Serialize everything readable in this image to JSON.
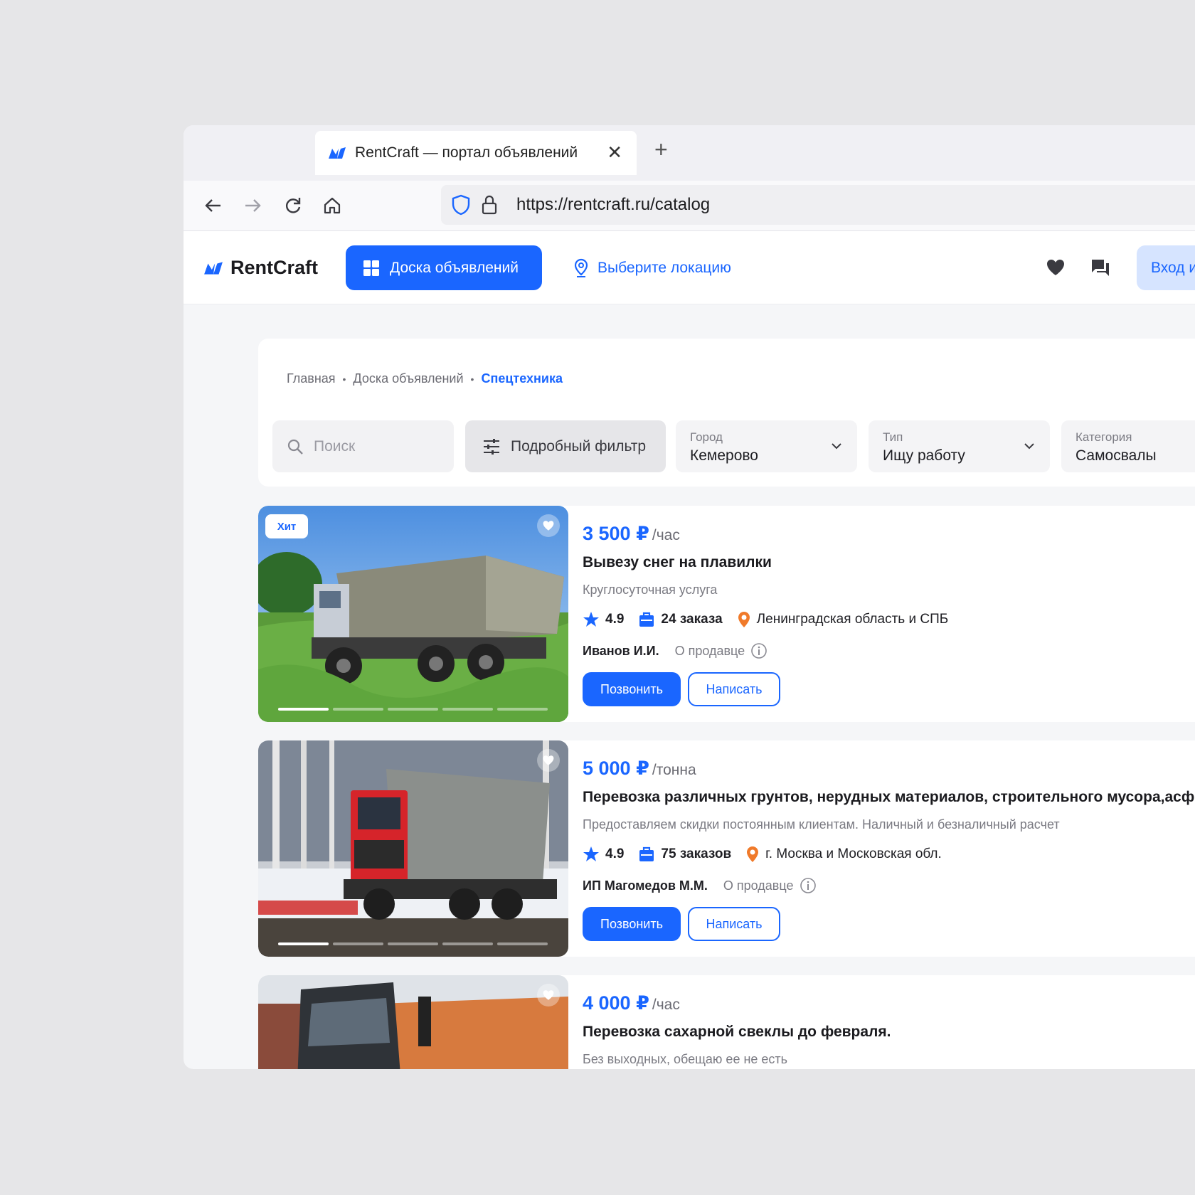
{
  "browser": {
    "tab_title": "RentCraft — портал объявлений",
    "url": "https://rentcraft.ru/catalog"
  },
  "header": {
    "brand": "RentCraft",
    "board_button": "Доска объявлений",
    "location_link": "Выберите локацию",
    "login_button": "Вход и"
  },
  "breadcrumbs": {
    "home": "Главная",
    "board": "Доска объявлений",
    "current": "Спецтехника"
  },
  "filters": {
    "search_placeholder": "Поиск",
    "advanced_filter": "Подробный фильтр",
    "city": {
      "label": "Город",
      "value": "Кемерово"
    },
    "type": {
      "label": "Тип",
      "value": "Ищу работу"
    },
    "category": {
      "label": "Категория",
      "value": "Самосвалы"
    }
  },
  "listings": [
    {
      "badge": "Хит",
      "price": "3 500 ₽",
      "unit": "/час",
      "title": "Вывезу снег на плавилки",
      "description": "Круглосуточная услуга",
      "rating": "4.9",
      "orders": "24 заказа",
      "region": "Ленинградская область и СПБ",
      "seller": "Иванов И.И.",
      "about": "О продавце",
      "call": "Позвонить",
      "write": "Написать"
    },
    {
      "price": "5 000 ₽",
      "unit": "/тонна",
      "title": "Перевозка различных грунтов, нерудных материалов, строительного мусора,асф",
      "description": "Предоставляем скидки постоянным клиентам. Наличный и безналичный расчет",
      "rating": "4.9",
      "orders": "75 заказов",
      "region": "г. Москва и Московская обл.",
      "seller": "ИП Магомедов М.М.",
      "about": "О продавце",
      "call": "Позвонить",
      "write": "Написать"
    },
    {
      "price": "4 000 ₽",
      "unit": "/час",
      "title": "Перевозка сахарной свеклы до февраля.",
      "description": "Без выходных, обещаю ее не есть"
    }
  ],
  "colors": {
    "accent": "#1a66ff",
    "accent_light": "#d6e4ff",
    "location_pin": "#f07a2a",
    "background": "#e6e6e8"
  },
  "icons": [
    "favicon-icon",
    "close-icon",
    "plus-icon",
    "back-icon",
    "forward-icon",
    "reload-icon",
    "home-icon",
    "shield-icon",
    "lock-icon",
    "grid-icon",
    "pin-icon",
    "heart-icon",
    "chat-icon",
    "search-icon",
    "sliders-icon",
    "chevron-down-icon",
    "star-icon",
    "briefcase-icon",
    "info-icon"
  ]
}
